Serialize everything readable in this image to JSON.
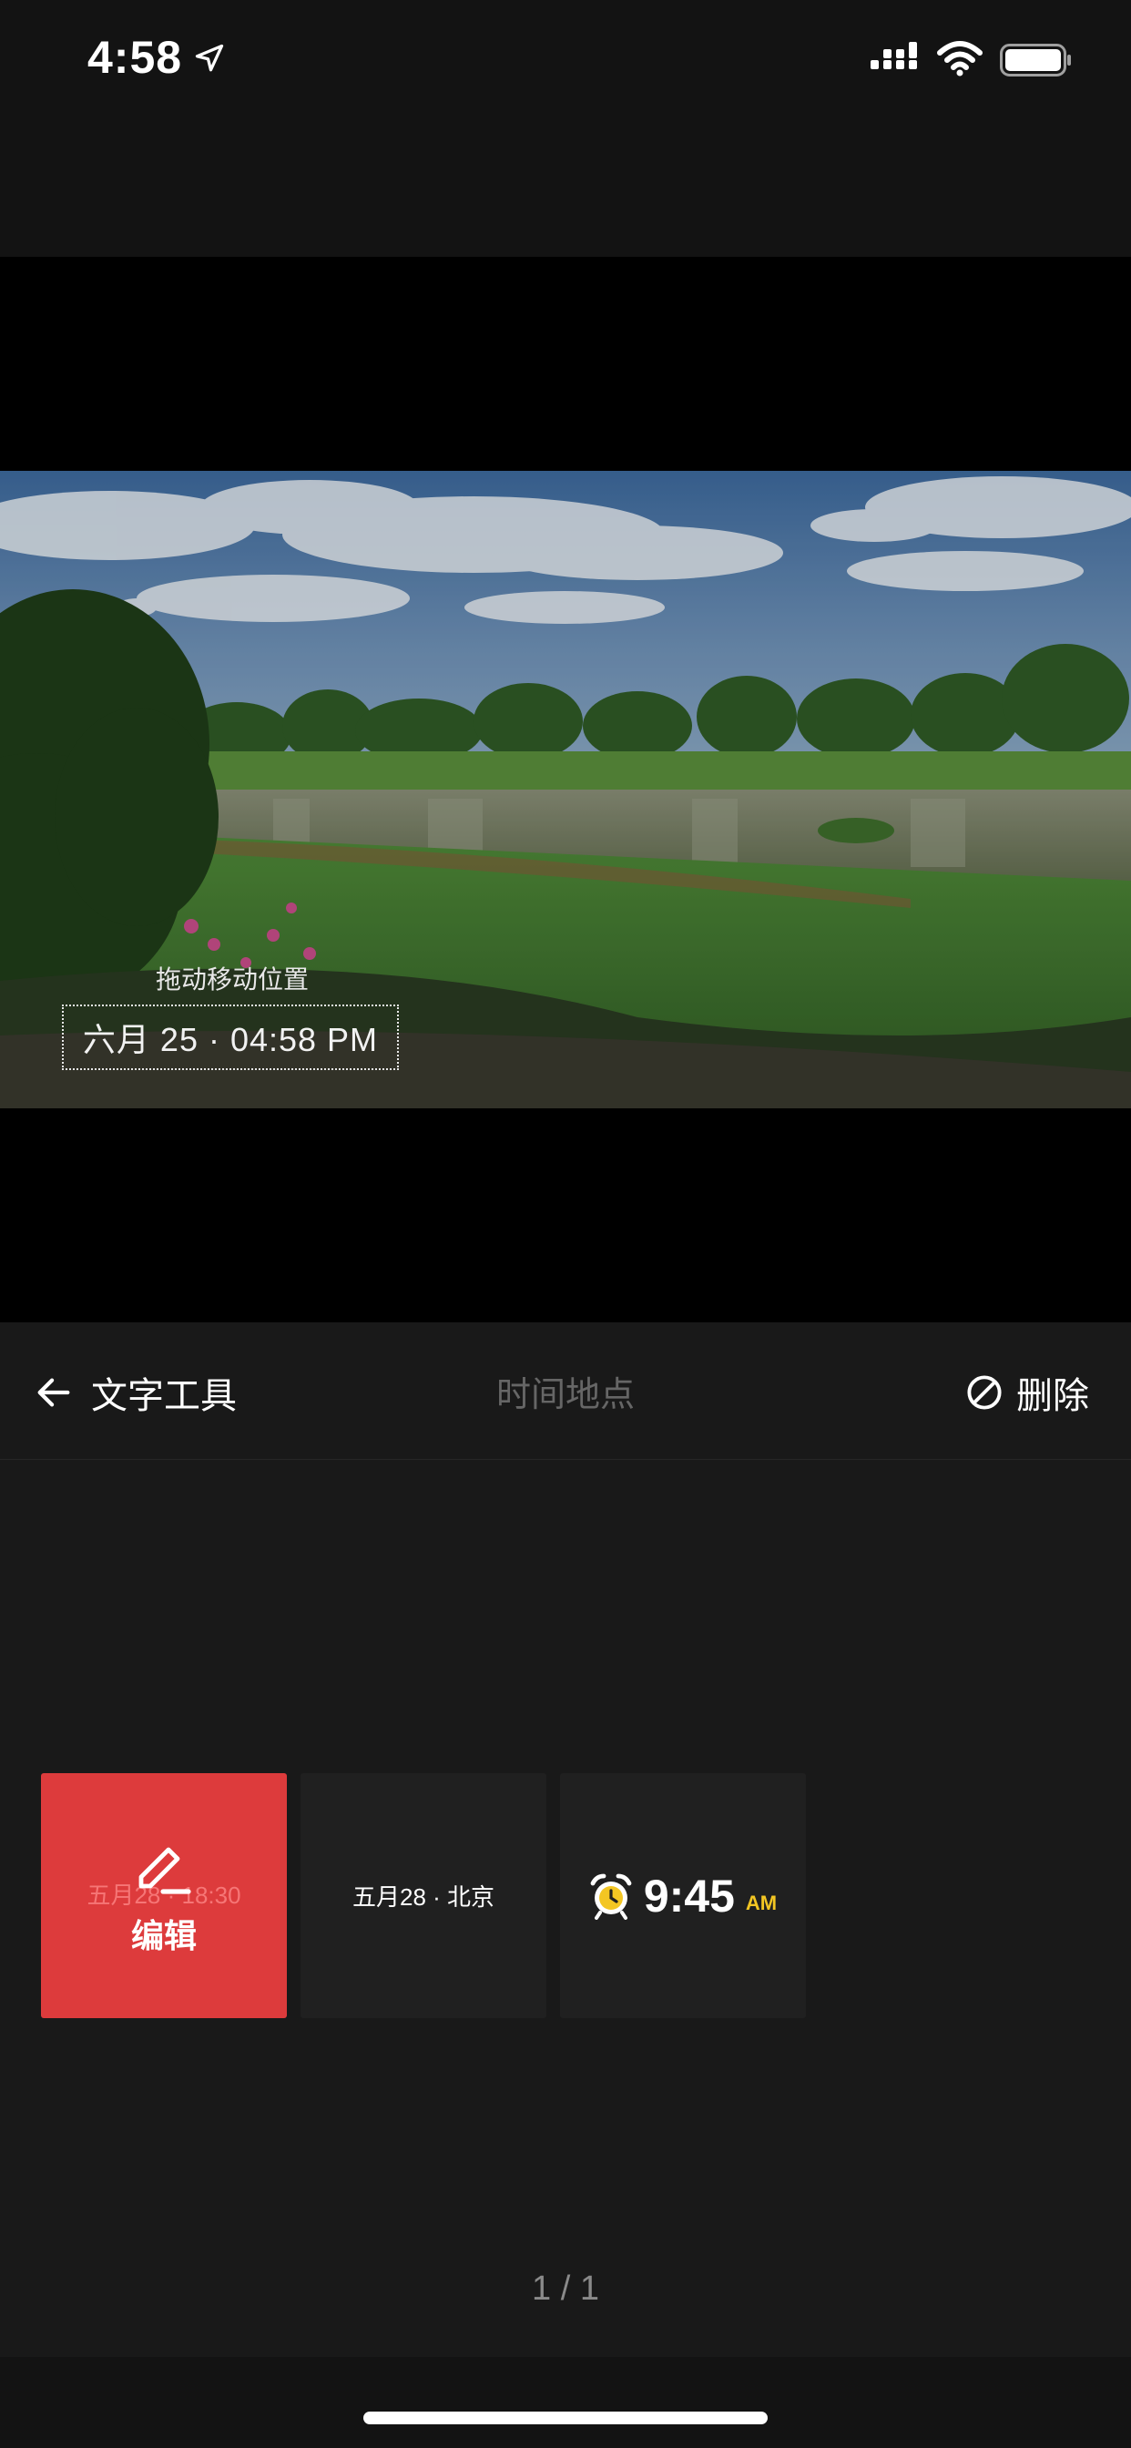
{
  "status_bar": {
    "time": "4:58",
    "icons": [
      "location-arrow-icon",
      "cellular-signal-icon",
      "wifi-icon",
      "battery-icon"
    ]
  },
  "preview": {
    "drag_hint": "拖动移动位置",
    "stamp_text": "六月 25 · 04:58 PM"
  },
  "toolbar": {
    "back_label": "文字工具",
    "title": "时间地点",
    "delete_label": "删除"
  },
  "templates": [
    {
      "preview_text": "五月28 · 18:30",
      "action_label": "编辑",
      "selected": true
    },
    {
      "preview_text": "五月28 · 北京",
      "selected": false
    },
    {
      "time": "9:45",
      "ampm": "AM",
      "icon": "alarm-clock-icon",
      "selected": false
    }
  ],
  "pagination": {
    "text": "1 / 1"
  },
  "colors": {
    "accent": "#dd3b3c",
    "background": "#191919",
    "highlight_yellow": "#f3c623"
  }
}
